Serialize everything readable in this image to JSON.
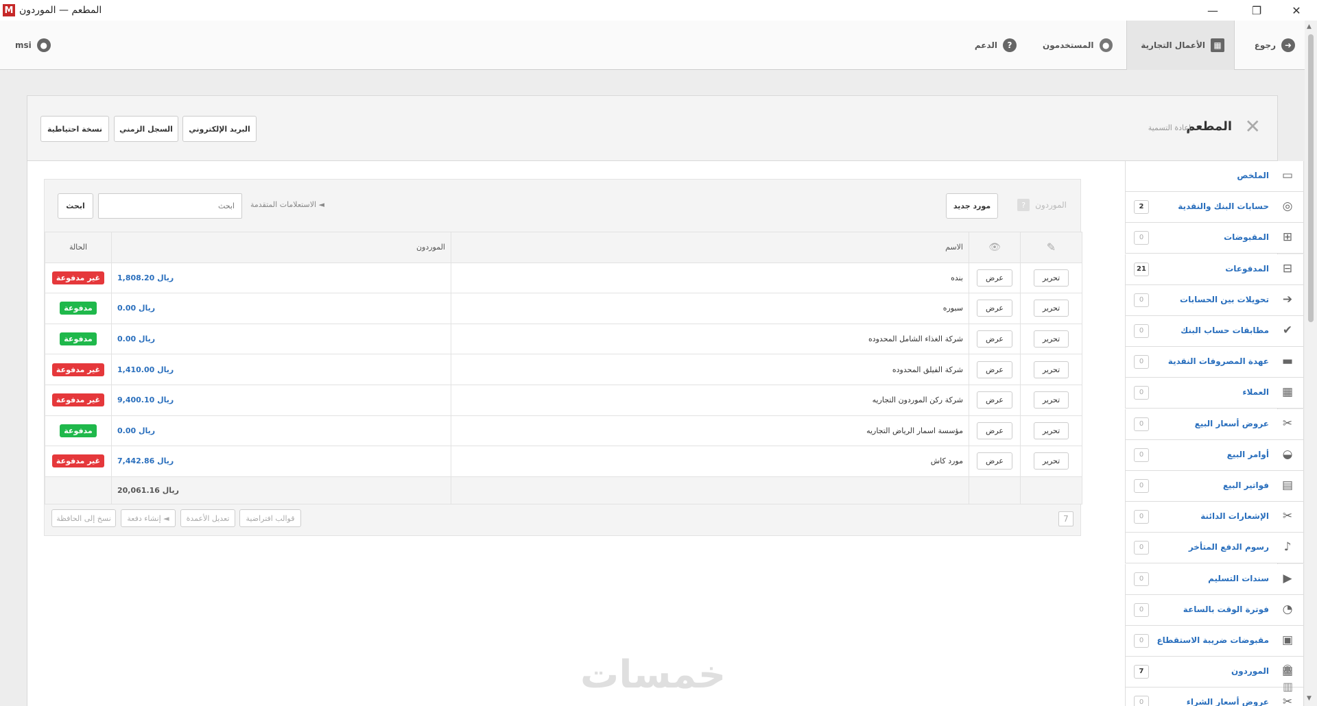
{
  "window": {
    "title": "المطعم — الموردون",
    "app_icon_letter": "M",
    "minimize": "—",
    "maximize": "❐",
    "close": "✕"
  },
  "topnav": {
    "back": "رجوع",
    "business": "الأعمال التجارية",
    "users": "المستخدمون",
    "support": "الدعم",
    "user": "msi"
  },
  "panel": {
    "title": "المطعم",
    "rename": "إعادة التسمية",
    "buttons": {
      "email": "البريد الإلكتروني",
      "timeline": "السجل الزمني",
      "backup": "نسخة احتياطية"
    }
  },
  "sidebar": {
    "items": [
      {
        "label": "الملخص",
        "count": "",
        "icon": "summary-icon"
      },
      {
        "label": "حسابات البنك والنقدية",
        "count": "2",
        "icon": "bank-icon"
      },
      {
        "label": "المقبوضات",
        "count": "0",
        "icon": "receipts-icon"
      },
      {
        "label": "المدفوعات",
        "count": "21",
        "icon": "payments-icon"
      },
      {
        "label": "تحويلات بين الحسابات",
        "count": "0",
        "icon": "transfer-icon"
      },
      {
        "label": "مطابقات حساب البنك",
        "count": "0",
        "icon": "reconcile-icon"
      },
      {
        "label": "عهدة المصروفات النقدية",
        "count": "0",
        "icon": "wallet-icon"
      },
      {
        "label": "العملاء",
        "count": "0",
        "icon": "customers-icon"
      },
      {
        "label": "عروض أسعار البيع",
        "count": "0",
        "icon": "quote-icon"
      },
      {
        "label": "أوامر البيع",
        "count": "0",
        "icon": "basket-icon"
      },
      {
        "label": "فواتير البيع",
        "count": "0",
        "icon": "invoice-icon"
      },
      {
        "label": "الإشعارات الدائنة",
        "count": "0",
        "icon": "scissors-icon"
      },
      {
        "label": "رسوم الدفع المتأخر",
        "count": "0",
        "icon": "bell-icon"
      },
      {
        "label": "سندات التسليم",
        "count": "0",
        "icon": "truck-icon"
      },
      {
        "label": "فوترة الوقت بالساعة",
        "count": "0",
        "icon": "stopwatch-icon"
      },
      {
        "label": "مقبوضات ضريبة الاستقطاع",
        "count": "0",
        "icon": "tax-icon"
      },
      {
        "label": "الموردون",
        "count": "7",
        "icon": "suppliers-icon"
      },
      {
        "label": "عروض أسعار الشراء",
        "count": "0",
        "icon": "purchase-quote-icon"
      }
    ]
  },
  "toolbar": {
    "title": "الموردون",
    "help": "?",
    "new_supplier": "مورد جديد",
    "advanced_queries": "◄ الاستعلامات المتقدمة",
    "search_placeholder": "ابحث",
    "search_button": "ابحث"
  },
  "table": {
    "headers": {
      "edit_icon": "✎",
      "view_icon": "👁",
      "name": "الاسم",
      "amount": "الموردون",
      "status": "الحالة"
    },
    "edit_label": "تحرير",
    "view_label": "عرض",
    "rows": [
      {
        "name": "بنده",
        "amount": "ريال 1,808.20",
        "status": "غير مدفوعة",
        "paid": false
      },
      {
        "name": "سبوره",
        "amount": "ريال 0.00",
        "status": "مدفوعة",
        "paid": true
      },
      {
        "name": "شركة الغذاء الشامل المحدوده",
        "amount": "ريال 0.00",
        "status": "مدفوعة",
        "paid": true
      },
      {
        "name": "شركة الفيلق المحدوده",
        "amount": "ريال 1,410.00",
        "status": "غير مدفوعة",
        "paid": false
      },
      {
        "name": "شركة ركن الموردون التجاريه",
        "amount": "ريال 9,400.10",
        "status": "غير مدفوعة",
        "paid": false
      },
      {
        "name": "مؤسسة اسمار الرياض التجاريه",
        "amount": "ريال 0.00",
        "status": "مدفوعة",
        "paid": true
      },
      {
        "name": "مورد كاش",
        "amount": "ريال 7,442.86",
        "status": "غير مدفوعة",
        "paid": false
      }
    ],
    "total": "ريال 20,061.16"
  },
  "bottom": {
    "count": "7",
    "templates": "قوالب افتراضية",
    "edit_columns": "تعديل الأعمدة",
    "batch_create": "◄ إنشاء دفعة",
    "copy_clipboard": "نسخ إلى الحافظة"
  },
  "watermark": "خمسات",
  "colors": {
    "link": "#2a6fbd",
    "unpaid": "#e5383b",
    "paid": "#1fb84b"
  }
}
